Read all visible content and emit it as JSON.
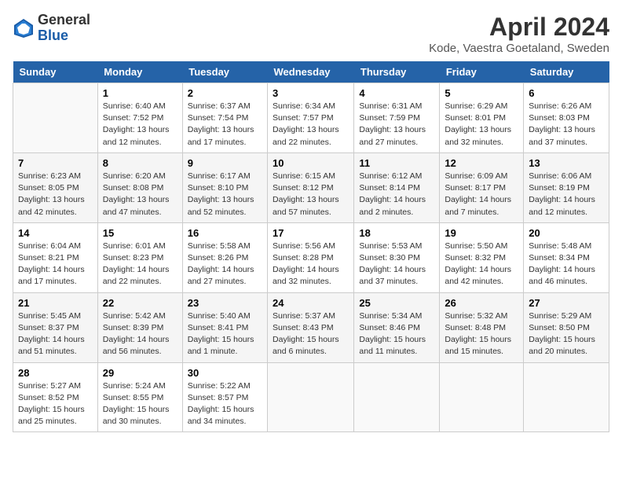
{
  "header": {
    "logo_general": "General",
    "logo_blue": "Blue",
    "month": "April 2024",
    "location": "Kode, Vaestra Goetaland, Sweden"
  },
  "weekdays": [
    "Sunday",
    "Monday",
    "Tuesday",
    "Wednesday",
    "Thursday",
    "Friday",
    "Saturday"
  ],
  "weeks": [
    [
      {
        "day": "",
        "info": ""
      },
      {
        "day": "1",
        "info": "Sunrise: 6:40 AM\nSunset: 7:52 PM\nDaylight: 13 hours\nand 12 minutes."
      },
      {
        "day": "2",
        "info": "Sunrise: 6:37 AM\nSunset: 7:54 PM\nDaylight: 13 hours\nand 17 minutes."
      },
      {
        "day": "3",
        "info": "Sunrise: 6:34 AM\nSunset: 7:57 PM\nDaylight: 13 hours\nand 22 minutes."
      },
      {
        "day": "4",
        "info": "Sunrise: 6:31 AM\nSunset: 7:59 PM\nDaylight: 13 hours\nand 27 minutes."
      },
      {
        "day": "5",
        "info": "Sunrise: 6:29 AM\nSunset: 8:01 PM\nDaylight: 13 hours\nand 32 minutes."
      },
      {
        "day": "6",
        "info": "Sunrise: 6:26 AM\nSunset: 8:03 PM\nDaylight: 13 hours\nand 37 minutes."
      }
    ],
    [
      {
        "day": "7",
        "info": "Sunrise: 6:23 AM\nSunset: 8:05 PM\nDaylight: 13 hours\nand 42 minutes."
      },
      {
        "day": "8",
        "info": "Sunrise: 6:20 AM\nSunset: 8:08 PM\nDaylight: 13 hours\nand 47 minutes."
      },
      {
        "day": "9",
        "info": "Sunrise: 6:17 AM\nSunset: 8:10 PM\nDaylight: 13 hours\nand 52 minutes."
      },
      {
        "day": "10",
        "info": "Sunrise: 6:15 AM\nSunset: 8:12 PM\nDaylight: 13 hours\nand 57 minutes."
      },
      {
        "day": "11",
        "info": "Sunrise: 6:12 AM\nSunset: 8:14 PM\nDaylight: 14 hours\nand 2 minutes."
      },
      {
        "day": "12",
        "info": "Sunrise: 6:09 AM\nSunset: 8:17 PM\nDaylight: 14 hours\nand 7 minutes."
      },
      {
        "day": "13",
        "info": "Sunrise: 6:06 AM\nSunset: 8:19 PM\nDaylight: 14 hours\nand 12 minutes."
      }
    ],
    [
      {
        "day": "14",
        "info": "Sunrise: 6:04 AM\nSunset: 8:21 PM\nDaylight: 14 hours\nand 17 minutes."
      },
      {
        "day": "15",
        "info": "Sunrise: 6:01 AM\nSunset: 8:23 PM\nDaylight: 14 hours\nand 22 minutes."
      },
      {
        "day": "16",
        "info": "Sunrise: 5:58 AM\nSunset: 8:26 PM\nDaylight: 14 hours\nand 27 minutes."
      },
      {
        "day": "17",
        "info": "Sunrise: 5:56 AM\nSunset: 8:28 PM\nDaylight: 14 hours\nand 32 minutes."
      },
      {
        "day": "18",
        "info": "Sunrise: 5:53 AM\nSunset: 8:30 PM\nDaylight: 14 hours\nand 37 minutes."
      },
      {
        "day": "19",
        "info": "Sunrise: 5:50 AM\nSunset: 8:32 PM\nDaylight: 14 hours\nand 42 minutes."
      },
      {
        "day": "20",
        "info": "Sunrise: 5:48 AM\nSunset: 8:34 PM\nDaylight: 14 hours\nand 46 minutes."
      }
    ],
    [
      {
        "day": "21",
        "info": "Sunrise: 5:45 AM\nSunset: 8:37 PM\nDaylight: 14 hours\nand 51 minutes."
      },
      {
        "day": "22",
        "info": "Sunrise: 5:42 AM\nSunset: 8:39 PM\nDaylight: 14 hours\nand 56 minutes."
      },
      {
        "day": "23",
        "info": "Sunrise: 5:40 AM\nSunset: 8:41 PM\nDaylight: 15 hours\nand 1 minute."
      },
      {
        "day": "24",
        "info": "Sunrise: 5:37 AM\nSunset: 8:43 PM\nDaylight: 15 hours\nand 6 minutes."
      },
      {
        "day": "25",
        "info": "Sunrise: 5:34 AM\nSunset: 8:46 PM\nDaylight: 15 hours\nand 11 minutes."
      },
      {
        "day": "26",
        "info": "Sunrise: 5:32 AM\nSunset: 8:48 PM\nDaylight: 15 hours\nand 15 minutes."
      },
      {
        "day": "27",
        "info": "Sunrise: 5:29 AM\nSunset: 8:50 PM\nDaylight: 15 hours\nand 20 minutes."
      }
    ],
    [
      {
        "day": "28",
        "info": "Sunrise: 5:27 AM\nSunset: 8:52 PM\nDaylight: 15 hours\nand 25 minutes."
      },
      {
        "day": "29",
        "info": "Sunrise: 5:24 AM\nSunset: 8:55 PM\nDaylight: 15 hours\nand 30 minutes."
      },
      {
        "day": "30",
        "info": "Sunrise: 5:22 AM\nSunset: 8:57 PM\nDaylight: 15 hours\nand 34 minutes."
      },
      {
        "day": "",
        "info": ""
      },
      {
        "day": "",
        "info": ""
      },
      {
        "day": "",
        "info": ""
      },
      {
        "day": "",
        "info": ""
      }
    ]
  ]
}
